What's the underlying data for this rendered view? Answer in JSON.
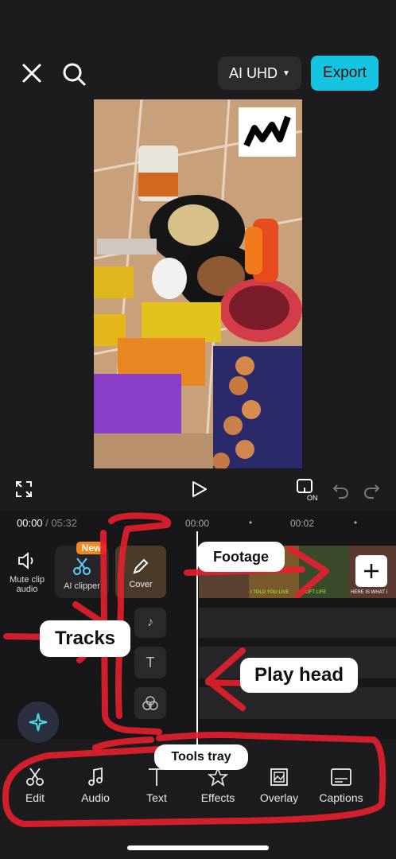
{
  "header": {
    "quality_label": "AI UHD",
    "export_label": "Export"
  },
  "timeline": {
    "current_time": "00:00",
    "separator": "/",
    "total_time": "05:32",
    "ruler_start": "00:00",
    "ruler_next": "00:02"
  },
  "side_tools": {
    "mute_label": "Mute clip audio",
    "ai_clipper_label": "AI clipper",
    "new_badge": "New",
    "cover_label": "Cover"
  },
  "clip_captions": [
    "I TOLD YOU LIVE",
    "SOFT LIFE",
    "HERE IS WHAT I"
  ],
  "annotations": {
    "footage": "Footage",
    "tracks": "Tracks",
    "play_head": "Play head",
    "tools_tray": "Tools tray"
  },
  "toolbar": [
    "Edit",
    "Audio",
    "Text",
    "Effects",
    "Overlay",
    "Captions"
  ],
  "colors": {
    "accent": "#15c4e0",
    "annotation_red": "#e5202e",
    "badge": "#f08a1c",
    "background": "#1c1c1e"
  },
  "icons": [
    "close-icon",
    "search-icon",
    "expand-icon",
    "play-icon",
    "undo-icon",
    "redo-icon",
    "scissors-icon",
    "music-note-icon",
    "text-icon",
    "star-icon",
    "image-icon",
    "captions-icon",
    "plus-icon"
  ]
}
